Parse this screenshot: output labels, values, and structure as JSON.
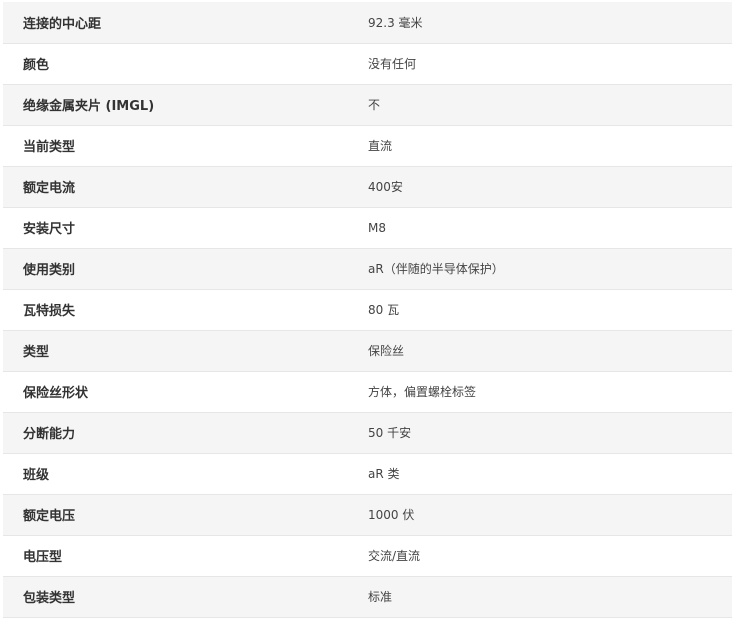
{
  "specs": [
    {
      "label": "连接的中心距",
      "value": "92.3 毫米"
    },
    {
      "label": "颜色",
      "value": "没有任何"
    },
    {
      "label": "绝缘金属夹片 (IMGL)",
      "value": "不"
    },
    {
      "label": "当前类型",
      "value": "直流"
    },
    {
      "label": "额定电流",
      "value": "400安"
    },
    {
      "label": "安装尺寸",
      "value": "M8"
    },
    {
      "label": "使用类别",
      "value": "aR（伴随的半导体保护）"
    },
    {
      "label": "瓦特损失",
      "value": "80 瓦"
    },
    {
      "label": "类型",
      "value": "保险丝"
    },
    {
      "label": "保险丝形状",
      "value": "方体，偏置螺栓标签"
    },
    {
      "label": "分断能力",
      "value": "50 千安"
    },
    {
      "label": "班级",
      "value": "aR 类"
    },
    {
      "label": "额定电压",
      "value": "1000 伏"
    },
    {
      "label": "电压型",
      "value": "交流/直流"
    },
    {
      "label": "包装类型",
      "value": "标准"
    }
  ]
}
